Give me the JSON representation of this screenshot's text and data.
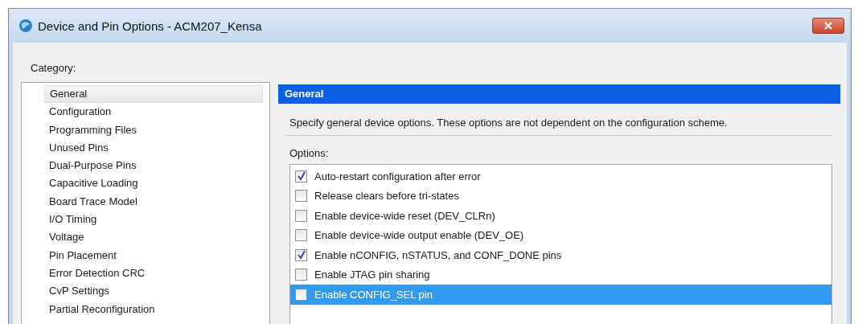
{
  "window": {
    "title": "Device and Pin Options - ACM207_Kensa"
  },
  "category": {
    "label": "Category:",
    "items": [
      {
        "label": "General",
        "selected": true
      },
      {
        "label": "Configuration",
        "selected": false
      },
      {
        "label": "Programming Files",
        "selected": false
      },
      {
        "label": "Unused Pins",
        "selected": false
      },
      {
        "label": "Dual-Purpose Pins",
        "selected": false
      },
      {
        "label": "Capacitive Loading",
        "selected": false
      },
      {
        "label": "Board Trace Model",
        "selected": false
      },
      {
        "label": "I/O Timing",
        "selected": false
      },
      {
        "label": "Voltage",
        "selected": false
      },
      {
        "label": "Pin Placement",
        "selected": false
      },
      {
        "label": "Error Detection CRC",
        "selected": false
      },
      {
        "label": "CvP Settings",
        "selected": false
      },
      {
        "label": "Partial Reconfiguration",
        "selected": false
      }
    ]
  },
  "panel": {
    "title": "General",
    "description": "Specify general device options. These options are not dependent on the configuration scheme.",
    "options_label": "Options:",
    "options": [
      {
        "label": "Auto-restart configuration after error",
        "checked": true,
        "selected": false
      },
      {
        "label": "Release clears before tri-states",
        "checked": false,
        "selected": false
      },
      {
        "label": "Enable device-wide reset (DEV_CLRn)",
        "checked": false,
        "selected": false
      },
      {
        "label": "Enable device-wide output enable (DEV_OE)",
        "checked": false,
        "selected": false
      },
      {
        "label": "Enable nCONFIG, nSTATUS, and CONF_DONE pins",
        "checked": true,
        "selected": false
      },
      {
        "label": "Enable JTAG pin sharing",
        "checked": false,
        "selected": false
      },
      {
        "label": "Enable CONFIG_SEL pin",
        "checked": false,
        "selected": true
      }
    ]
  }
}
